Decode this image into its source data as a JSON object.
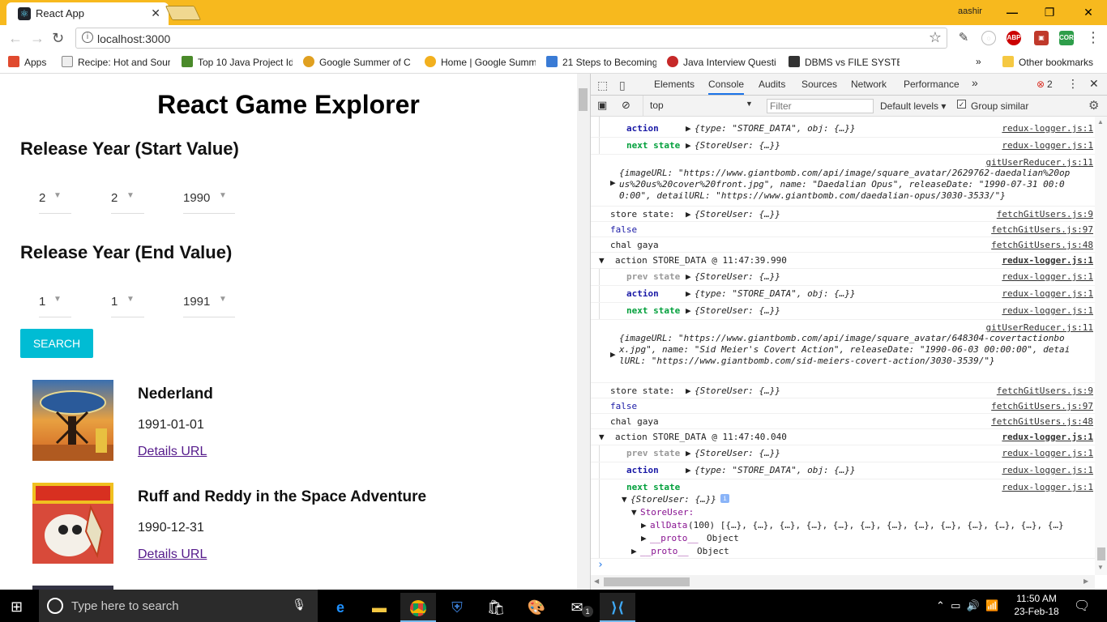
{
  "browser": {
    "tab_title": "React App",
    "user": "aashir",
    "url": "localhost:3000",
    "bookmarks": [
      {
        "label": "Apps",
        "color": "#e04a2f"
      },
      {
        "label": "Recipe: Hot and Sour",
        "color": "#888888"
      },
      {
        "label": "Top 10 Java Project Id",
        "color": "#4a8a2a"
      },
      {
        "label": "Google Summer of C",
        "color": "#e0a020"
      },
      {
        "label": "Home | Google Summ",
        "color": "#f2b01e"
      },
      {
        "label": "21 Steps to Becoming",
        "color": "#3a7bd5"
      },
      {
        "label": "Java Interview Questi",
        "color": "#c62828"
      },
      {
        "label": "DBMS vs FILE SYSTEM",
        "color": "#333333"
      }
    ],
    "bookmarks_more": "»",
    "other_bookmarks": "Other bookmarks"
  },
  "app": {
    "title": "React Game Explorer",
    "start_heading": "Release Year (Start Value)",
    "end_heading": "Release Year (End Value)",
    "start": {
      "day": "2",
      "month": "2",
      "year": "1990"
    },
    "end": {
      "day": "1",
      "month": "1",
      "year": "1991"
    },
    "search_label": "SEARCH",
    "games": [
      {
        "name": "Nederland",
        "date": "1991-01-01",
        "link": "Details URL"
      },
      {
        "name": "Ruff and Reddy in the Space Adventure",
        "date": "1990-12-31",
        "link": "Details URL"
      }
    ]
  },
  "devtools": {
    "tabs": [
      "Elements",
      "Console",
      "Audits",
      "Sources",
      "Network",
      "Performance"
    ],
    "active_tab": "Console",
    "more": "»",
    "error_count": "2",
    "context": "top",
    "filter_placeholder": "Filter",
    "levels": "Default levels ▾",
    "group_similar": "Group similar",
    "lines": {
      "action1": "action",
      "action1_val": "{type: \"STORE_DATA\", obj: {…}}",
      "next1": "next state",
      "next1_val": "{StoreUser: {…}}",
      "src_logger": "redux-logger.js:1",
      "src_reducer": "gitUserReducer.js:11",
      "obj1": "{imageURL: \"https://www.giantbomb.com/api/image/square_avatar/2629762-daedalian%20opus%20us%20cover%20front.jpg\", name: \"Daedalian Opus\", releaseDate: \"1990-07-31 00:00:00\", detailURL: \"https://www.giantbomb.com/daedalian-opus/3030-3533/\"}",
      "store_state": "store state:",
      "store_val": "{StoreUser: {…}}",
      "src_fetch9": "fetchGitUsers.js:9",
      "false": "false",
      "src_fetch97": "fetchGitUsers.js:97",
      "chal": "chal gaya",
      "src_fetch48": "fetchGitUsers.js:48",
      "group2": "action STORE_DATA @ 11:47:39.990",
      "prev": "prev state",
      "prev_val": "{StoreUser: {…}}",
      "obj2": "{imageURL: \"https://www.giantbomb.com/api/image/square_avatar/648304-covertactionbox.jpg\", name: \"Sid Meier's Covert Action\", releaseDate: \"1990-06-03 00:00:00\", detailURL: \"https://www.giantbomb.com/sid-meiers-covert-action/3030-3539/\"}",
      "group3": "action STORE_DATA @ 11:47:40.040",
      "tree1": "{StoreUser: {…}}",
      "tree2": "StoreUser:",
      "tree3_key": "allData",
      "tree3_val": "(100) [{…}, {…}, {…}, {…}, {…}, {…}, {…}, {…}, {…}, {…}, {…}, {…}, {…}",
      "tree4_key": "__proto__",
      "tree4_val": "Object",
      "tree5_key": "__proto__",
      "tree5_val": "Object",
      "prompt": "›"
    }
  },
  "taskbar": {
    "search_placeholder": "Type here to search",
    "time": "11:50 AM",
    "date": "23-Feb-18",
    "mail_badge": "1"
  }
}
